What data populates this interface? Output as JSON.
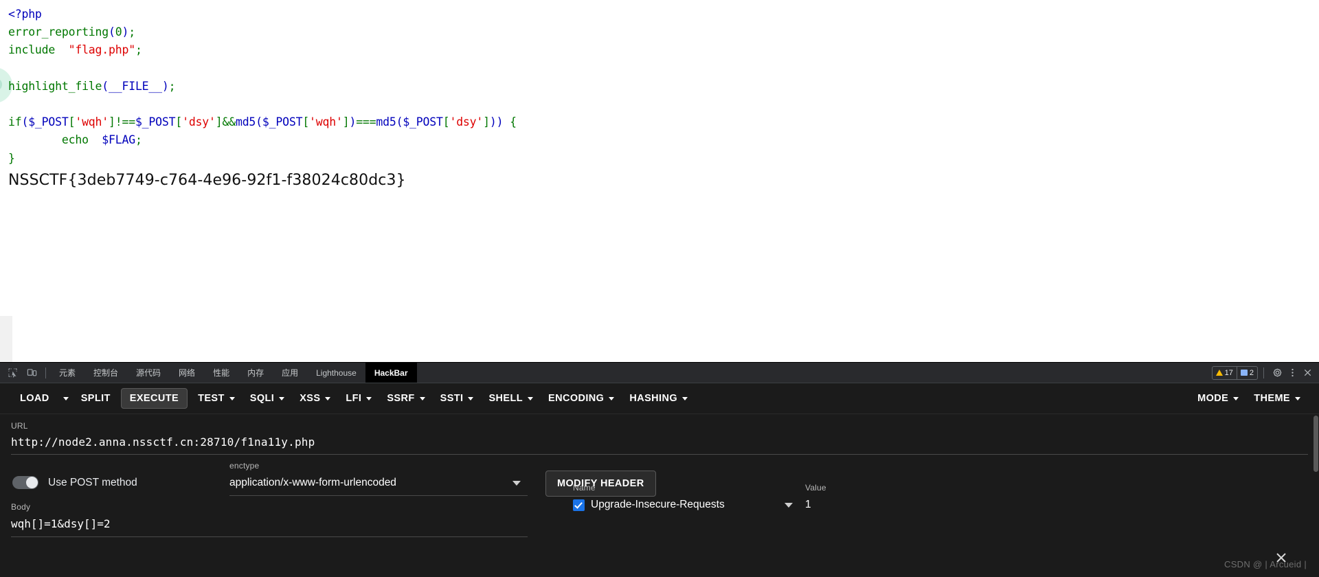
{
  "page": {
    "code": {
      "lines": [
        [
          {
            "t": "<?php",
            "c": "tok-html"
          }
        ],
        [
          {
            "t": "error_reporting",
            "c": "tok-kw"
          },
          {
            "t": "(",
            "c": "tok-def"
          },
          {
            "t": "0",
            "c": "tok-kw"
          },
          {
            "t": ")",
            "c": "tok-def"
          },
          {
            "t": ";",
            "c": "tok-kw"
          }
        ],
        [
          {
            "t": "include",
            "c": "tok-kw"
          },
          {
            "t": "  ",
            "c": "tok-kw"
          },
          {
            "t": "\"flag.php\"",
            "c": "tok-str"
          },
          {
            "t": ";",
            "c": "tok-kw"
          }
        ],
        [],
        [
          {
            "t": "highlight_file",
            "c": "tok-kw"
          },
          {
            "t": "(",
            "c": "tok-def"
          },
          {
            "t": "__FILE__",
            "c": "tok-def"
          },
          {
            "t": ")",
            "c": "tok-def"
          },
          {
            "t": ";",
            "c": "tok-kw"
          }
        ],
        [],
        [
          {
            "t": "if",
            "c": "tok-kw"
          },
          {
            "t": "(",
            "c": "tok-def"
          },
          {
            "t": "$_POST",
            "c": "tok-var"
          },
          {
            "t": "[",
            "c": "tok-kw"
          },
          {
            "t": "'wqh'",
            "c": "tok-str"
          },
          {
            "t": "]",
            "c": "tok-kw"
          },
          {
            "t": "!==",
            "c": "tok-kw"
          },
          {
            "t": "$_POST",
            "c": "tok-var"
          },
          {
            "t": "[",
            "c": "tok-kw"
          },
          {
            "t": "'dsy'",
            "c": "tok-str"
          },
          {
            "t": "]",
            "c": "tok-kw"
          },
          {
            "t": "&&",
            "c": "tok-kw"
          },
          {
            "t": "md5",
            "c": "tok-def"
          },
          {
            "t": "(",
            "c": "tok-def"
          },
          {
            "t": "$_POST",
            "c": "tok-var"
          },
          {
            "t": "[",
            "c": "tok-kw"
          },
          {
            "t": "'wqh'",
            "c": "tok-str"
          },
          {
            "t": "]",
            "c": "tok-kw"
          },
          {
            "t": ")",
            "c": "tok-def"
          },
          {
            "t": "===",
            "c": "tok-kw"
          },
          {
            "t": "md5",
            "c": "tok-def"
          },
          {
            "t": "(",
            "c": "tok-def"
          },
          {
            "t": "$_POST",
            "c": "tok-var"
          },
          {
            "t": "[",
            "c": "tok-kw"
          },
          {
            "t": "'dsy'",
            "c": "tok-str"
          },
          {
            "t": "]",
            "c": "tok-kw"
          },
          {
            "t": "))",
            "c": "tok-def"
          },
          {
            "t": " {",
            "c": "tok-kw"
          }
        ],
        [
          {
            "t": "        echo  ",
            "c": "tok-kw"
          },
          {
            "t": "$FLAG",
            "c": "tok-var"
          },
          {
            "t": ";",
            "c": "tok-kw"
          }
        ],
        [
          {
            "t": "}",
            "c": "tok-kw"
          }
        ]
      ]
    },
    "flag": "NSSCTF{3deb7749-c764-4e96-92f1-f38024c80dc3}"
  },
  "devtools": {
    "tabs": [
      {
        "label": "元素",
        "active": false
      },
      {
        "label": "控制台",
        "active": false
      },
      {
        "label": "源代码",
        "active": false
      },
      {
        "label": "网络",
        "active": false
      },
      {
        "label": "性能",
        "active": false
      },
      {
        "label": "内存",
        "active": false
      },
      {
        "label": "应用",
        "active": false
      },
      {
        "label": "Lighthouse",
        "active": false
      },
      {
        "label": "HackBar",
        "active": true
      }
    ],
    "warnings_count": "17",
    "messages_count": "2",
    "icons": {
      "inspect": "inspect-element-icon",
      "device": "device-toolbar-icon",
      "settings": "gear-icon",
      "more": "more-vertical-icon",
      "close": "close-icon"
    }
  },
  "hackbar": {
    "buttons": [
      {
        "label": "LOAD",
        "caret": false,
        "boxed": false
      },
      {
        "label": "",
        "caret": true,
        "boxed": false
      },
      {
        "label": "SPLIT",
        "caret": false,
        "boxed": false
      },
      {
        "label": "EXECUTE",
        "caret": false,
        "boxed": true
      },
      {
        "label": "TEST",
        "caret": true,
        "boxed": false
      },
      {
        "label": "SQLI",
        "caret": true,
        "boxed": false
      },
      {
        "label": "XSS",
        "caret": true,
        "boxed": false
      },
      {
        "label": "LFI",
        "caret": true,
        "boxed": false
      },
      {
        "label": "SSRF",
        "caret": true,
        "boxed": false
      },
      {
        "label": "SSTI",
        "caret": true,
        "boxed": false
      },
      {
        "label": "SHELL",
        "caret": true,
        "boxed": false
      },
      {
        "label": "ENCODING",
        "caret": true,
        "boxed": false
      },
      {
        "label": "HASHING",
        "caret": true,
        "boxed": false
      }
    ],
    "right_buttons": [
      {
        "label": "MODE",
        "caret": true
      },
      {
        "label": "THEME",
        "caret": true
      }
    ],
    "url_label": "URL",
    "url_value": "http://node2.anna.nssctf.cn:28710/f1na11y.php",
    "post_toggle_label": "Use POST method",
    "enctype_label": "enctype",
    "enctype_value": "application/x-www-form-urlencoded",
    "modify_header_label": "MODIFY HEADER",
    "body_label": "Body",
    "body_value": "wqh[]=1&dsy[]=2",
    "header_name_label": "Name",
    "header_name_value": "Upgrade-Insecure-Requests",
    "header_value_label": "Value",
    "header_value_value": "1"
  },
  "watermark": "CSDN @ | Arcueid |"
}
